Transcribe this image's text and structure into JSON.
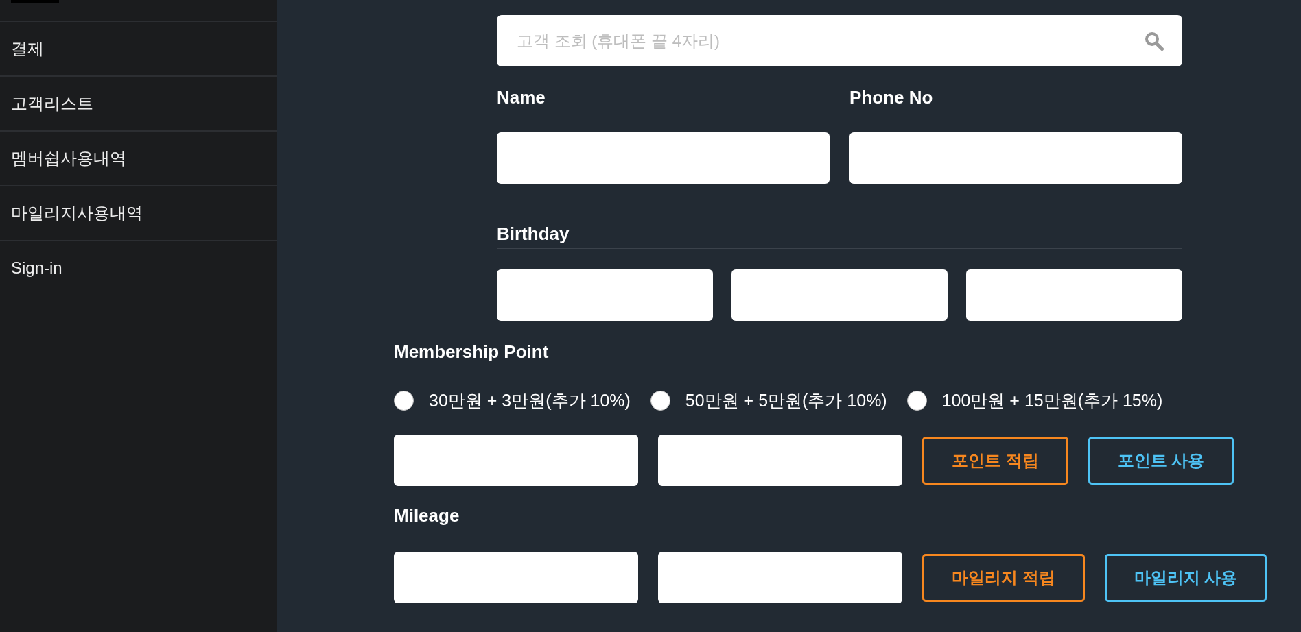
{
  "sidebar": {
    "items": [
      {
        "label": "결제"
      },
      {
        "label": "고객리스트"
      },
      {
        "label": "멤버쉽사용내역"
      },
      {
        "label": "마일리지사용내역"
      },
      {
        "label": "Sign-in"
      }
    ]
  },
  "search": {
    "placeholder": "고객 조회 (휴대폰 끝 4자리)"
  },
  "customer": {
    "fields": [
      {
        "label": "Name"
      },
      {
        "label": "Phone No"
      }
    ],
    "birthday": {
      "label": "Birthday"
    }
  },
  "membership": {
    "label": "Membership Point",
    "options": [
      {
        "label": "30만원 + 3만원(추가 10%)",
        "selected": false
      },
      {
        "label": "50만원 + 5만원(추가 10%)",
        "selected": false
      },
      {
        "label": "100만원 + 15만원(추가 15%)",
        "selected": false
      }
    ],
    "buttons": [
      {
        "label": "포인트 적립",
        "kind": "earn"
      },
      {
        "label": "포인트 사용",
        "kind": "use"
      }
    ]
  },
  "mileage": {
    "label": "Mileage",
    "buttons": [
      {
        "label": "마일리지 적립",
        "kind": "earn"
      },
      {
        "label": "마일리지 사용",
        "kind": "use"
      }
    ]
  }
}
